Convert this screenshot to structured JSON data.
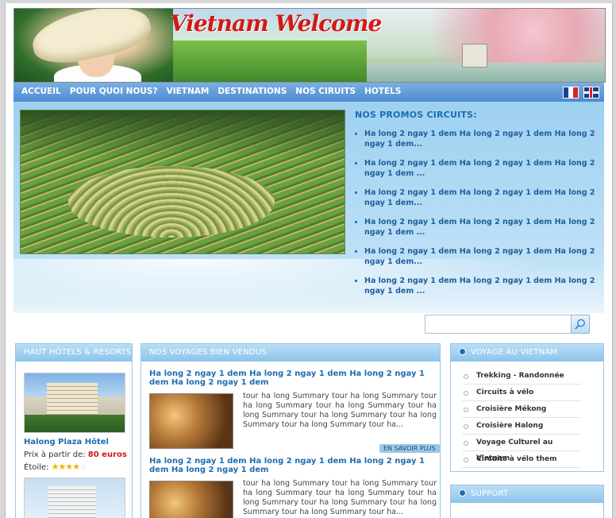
{
  "banner": {
    "title": "Vietnam Welcome"
  },
  "menu": {
    "items": [
      "ACCUEIL",
      "POUR QUOI NOUS?",
      "VIETNAM",
      "DESTINATIONS",
      "NOS CIRUITS",
      "HOTELS"
    ],
    "lang_fr": "French flag",
    "lang_en": "English flag"
  },
  "promos": {
    "title": "NOS PROMOS CIRCUITS:",
    "items": [
      "Ha long 2 ngay 1 dem Ha long 2 ngay 1 dem Ha long 2 ngay 1 dem...",
      "Ha long 2 ngay 1 dem Ha long 2 ngay 1 dem Ha long 2 ngay 1 dem ...",
      "Ha long 2 ngay 1 dem Ha long 2 ngay 1 dem Ha long 2 ngay 1 dem...",
      "Ha long 2 ngay 1 dem Ha long 2 ngay 1 dem Ha long 2 ngay 1 dem ...",
      "Ha long 2 ngay 1 dem Ha long 2 ngay 1 dem Ha long 2 ngay 1 dem...",
      "Ha long 2 ngay 1 dem Ha long 2 ngay 1 dem Ha long 2 ngay 1 dem ..."
    ]
  },
  "search": {
    "placeholder": "",
    "value": ""
  },
  "hotels": {
    "title": "HAUT HÔTELS & RESORTS",
    "name": "Halong Plaza Hôtel",
    "price_label": "Prix à partir de:",
    "price_value": "80 euros",
    "stars_label": "Étoile:",
    "stars_filled": "★★★★",
    "stars_empty": "☆"
  },
  "voyages": {
    "title": "NOS VOYAGES BIEN VENDUS",
    "tours": [
      {
        "title": "Ha long 2 ngay 1 dem Ha long 2 ngay 1 dem Ha long 2 ngay 1 dem Ha long 2 ngay 1 dem",
        "desc": "tour ha long Summary tour ha long Summary tour ha long Summary tour ha long Summary tour ha long Summary tour ha long Summary tour ha long Summary tour ha long Summary tour ha...",
        "more": "EN SAVOIR PLUS"
      },
      {
        "title": "Ha long 2 ngay 1 dem Ha long 2 ngay 1 dem Ha long 2 ngay 1 dem Ha long 2 ngay 1 dem",
        "desc": "tour ha long Summary tour ha long Summary tour ha long Summary tour ha long Summary tour ha long Summary tour ha long Summary tour ha long Summary tour ha long Summary tour ha..."
      }
    ]
  },
  "voyage_vietnam": {
    "title": "VOYAGE AU VIETNAM",
    "items": [
      "Trekking - Randonnée",
      "Circuits à vélo",
      "Croisière Mékong",
      "Croisière Halong",
      "Voyage Culturel au Vietnam",
      "Circuits à vélo them"
    ]
  },
  "support": {
    "title": "SUPPORT"
  }
}
